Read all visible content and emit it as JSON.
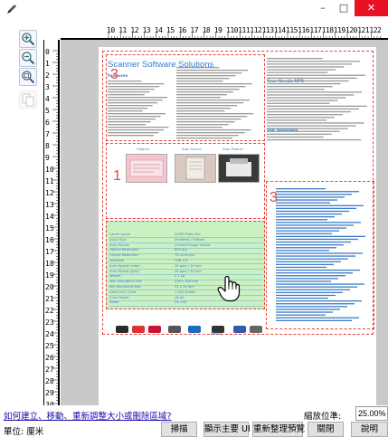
{
  "window": {
    "minimize_label": "–",
    "maximize_label": "□",
    "close_label": "✕"
  },
  "tools": [
    {
      "name": "zoom-in-icon"
    },
    {
      "name": "zoom-out-icon"
    },
    {
      "name": "zoom-fit-icon"
    },
    {
      "name": "copy-icon"
    }
  ],
  "ruler": {
    "horizontal": [
      "10",
      "11",
      "12",
      "13",
      "14",
      "15",
      "16",
      "17",
      "18",
      "19",
      "110",
      "111",
      "112",
      "113",
      "114",
      "115",
      "116",
      "117",
      "118",
      "119",
      "120",
      "121",
      "122"
    ],
    "vertical": [
      "0",
      "1",
      "2",
      "3",
      "4",
      "5",
      "6",
      "7",
      "8",
      "9",
      "10",
      "11",
      "12",
      "13",
      "14",
      "15",
      "16",
      "17",
      "18",
      "19",
      "20",
      "21",
      "22",
      "23",
      "24",
      "25",
      "26",
      "27",
      "28",
      "29",
      "30"
    ]
  },
  "document": {
    "title": "Scanner Software Solutions",
    "heading_features": "Features",
    "heading_your_needs": "Your Needs NPR",
    "heading_solutions": "Our Solutions",
    "captions": [
      "Original",
      "Scan Source",
      "Scan Product"
    ],
    "regions": [
      "1",
      "2",
      "3"
    ],
    "table_rows": [
      [
        "Lorem Ipsum",
        "ACME Photo Pro"
      ],
      [
        "Input Type",
        "Sheetfed / Flatbed"
      ],
      [
        "Scan Sensor",
        "Contact Image Sensor"
      ],
      [
        "Optical Resolution",
        "600 dpi"
      ],
      [
        "Output Resolution",
        "75-1200 dpi"
      ],
      [
        "Interface",
        "USB 2.0"
      ],
      [
        "Scan Speed (color)",
        "10 ppm / 20 ipm"
      ],
      [
        "Scan Speed (gray)",
        "20 ppm / 40 ipm"
      ],
      [
        "Weight",
        "2.1 kg"
      ],
      [
        "Max Document Size",
        "216 x 356 mm"
      ],
      [
        "Min Document Size",
        "52 x 74 mm"
      ],
      [
        "Daily Duty Cycle",
        "1,500 sheets"
      ],
      [
        "Color Depth",
        "48-bit"
      ],
      [
        "Power",
        "DC 24V"
      ]
    ],
    "logos": [
      "",
      "",
      "",
      "",
      "",
      "Ability",
      "",
      ""
    ]
  },
  "bottom": {
    "link_text": "如何建立、移動、重新調整大小或刪除區域?",
    "zoom_label": "縮放位準:",
    "zoom_value": "25.00%",
    "unit_label": "單位: 厘米",
    "buttons": [
      "掃描",
      "顯示主要 UI",
      "重新整理預覽",
      "關閉",
      "說明"
    ]
  }
}
